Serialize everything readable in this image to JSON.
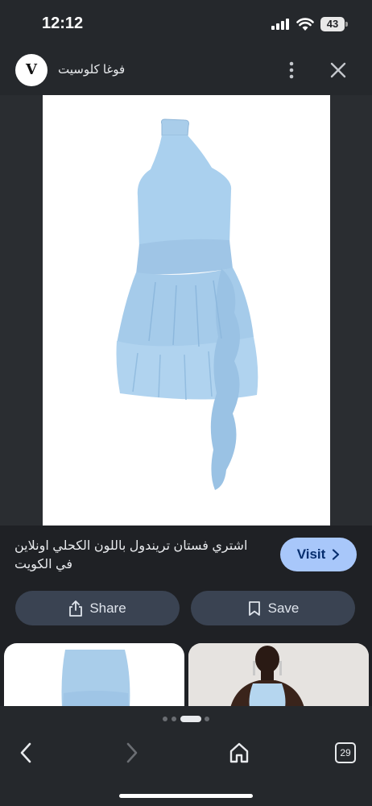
{
  "status_bar": {
    "time": "12:12",
    "battery": "43",
    "icons": [
      "signal-icon",
      "wifi-icon",
      "battery-icon"
    ]
  },
  "header": {
    "logo_letter": "V",
    "site_name": "فوغا كلوسيت",
    "icons": [
      "more-vert-icon",
      "close-icon"
    ]
  },
  "product": {
    "image_alt": "light blue halter dress",
    "dress_color": "#a9cdea",
    "caption": "اشتري فستان تريندول باللون الكحلي اونلاين في الكويت"
  },
  "actions": {
    "visit_label": "Visit",
    "share_label": "Share",
    "save_label": "Save"
  },
  "navigation": {
    "tab_count": "29",
    "icons": [
      "back-icon",
      "forward-icon",
      "home-icon",
      "tabs-icon"
    ]
  },
  "colors": {
    "background": "#1f2125",
    "visit_button": "#a8c7fa",
    "pill_button": "#3a4352"
  }
}
